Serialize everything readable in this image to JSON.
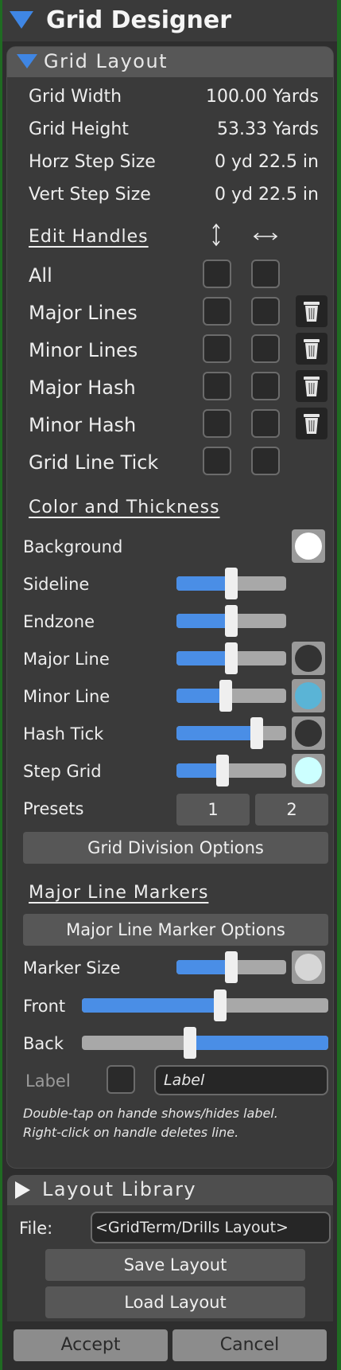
{
  "window": {
    "title": "Grid Designer"
  },
  "grid_layout": {
    "header": "Grid Layout",
    "properties": [
      {
        "label": "Grid Width",
        "value": "100.00 Yards"
      },
      {
        "label": "Grid Height",
        "value": "53.33 Yards"
      },
      {
        "label": "Horz Step Size",
        "value": "0 yd 22.5 in"
      },
      {
        "label": "Vert Step Size",
        "value": "0 yd 22.5 in"
      }
    ],
    "edit_handles": {
      "title": "Edit Handles",
      "column_icons": [
        "vertical-resize-arrow-icon",
        "horizontal-resize-arrow-icon"
      ],
      "rows": [
        {
          "label": "All",
          "vertical_checked": false,
          "horizontal_checked": false,
          "trash": false
        },
        {
          "label": "Major Lines",
          "vertical_checked": false,
          "horizontal_checked": false,
          "trash": true
        },
        {
          "label": "Minor Lines",
          "vertical_checked": false,
          "horizontal_checked": false,
          "trash": true
        },
        {
          "label": "Major Hash",
          "vertical_checked": false,
          "horizontal_checked": false,
          "trash": true
        },
        {
          "label": "Minor Hash",
          "vertical_checked": false,
          "horizontal_checked": false,
          "trash": true
        },
        {
          "label": "Grid Line Tick",
          "vertical_checked": false,
          "horizontal_checked": false,
          "trash": false
        }
      ]
    },
    "color_thickness": {
      "title": "Color and Thickness",
      "background": {
        "label": "Background",
        "color": "#ffffff"
      },
      "rows": [
        {
          "label": "Sideline",
          "value": 0.5,
          "color": null
        },
        {
          "label": "Endzone",
          "value": 0.5,
          "color": null
        },
        {
          "label": "Major Line",
          "value": 0.5,
          "color": "#333333"
        },
        {
          "label": "Minor Line",
          "value": 0.45,
          "color": "#5ab4d6"
        },
        {
          "label": "Hash Tick",
          "value": 0.73,
          "color": "#333333"
        },
        {
          "label": "Step Grid",
          "value": 0.42,
          "color": "#ccffff"
        }
      ],
      "presets": {
        "label": "Presets",
        "buttons": [
          "1",
          "2"
        ]
      },
      "division_button": "Grid Division Options"
    },
    "markers": {
      "title": "Major Line Markers",
      "options_button": "Major Line Marker Options",
      "marker_size": {
        "label": "Marker Size",
        "value": 0.5,
        "color": "#d6d6d6"
      },
      "front": {
        "label": "Front",
        "value": 0.56
      },
      "back": {
        "label": "Back",
        "value": 0.44
      },
      "label_row": {
        "label": "Label",
        "checked": false,
        "placeholder": "Label"
      },
      "hint_line1": "Double-tap on hande shows/hides label.",
      "hint_line2": "Right-click on handle deletes line."
    }
  },
  "layout_library": {
    "header": "Layout Library",
    "file_label": "File:",
    "file_value": "<GridTerm/Drills Layout>",
    "save_button": "Save Layout",
    "load_button": "Load Layout"
  },
  "footer": {
    "accept": "Accept",
    "cancel": "Cancel"
  },
  "colors": {
    "accent": "#4a8ee6",
    "panel": "#3a3a3a",
    "header": "#575757",
    "border_green": "#1f6b22"
  }
}
